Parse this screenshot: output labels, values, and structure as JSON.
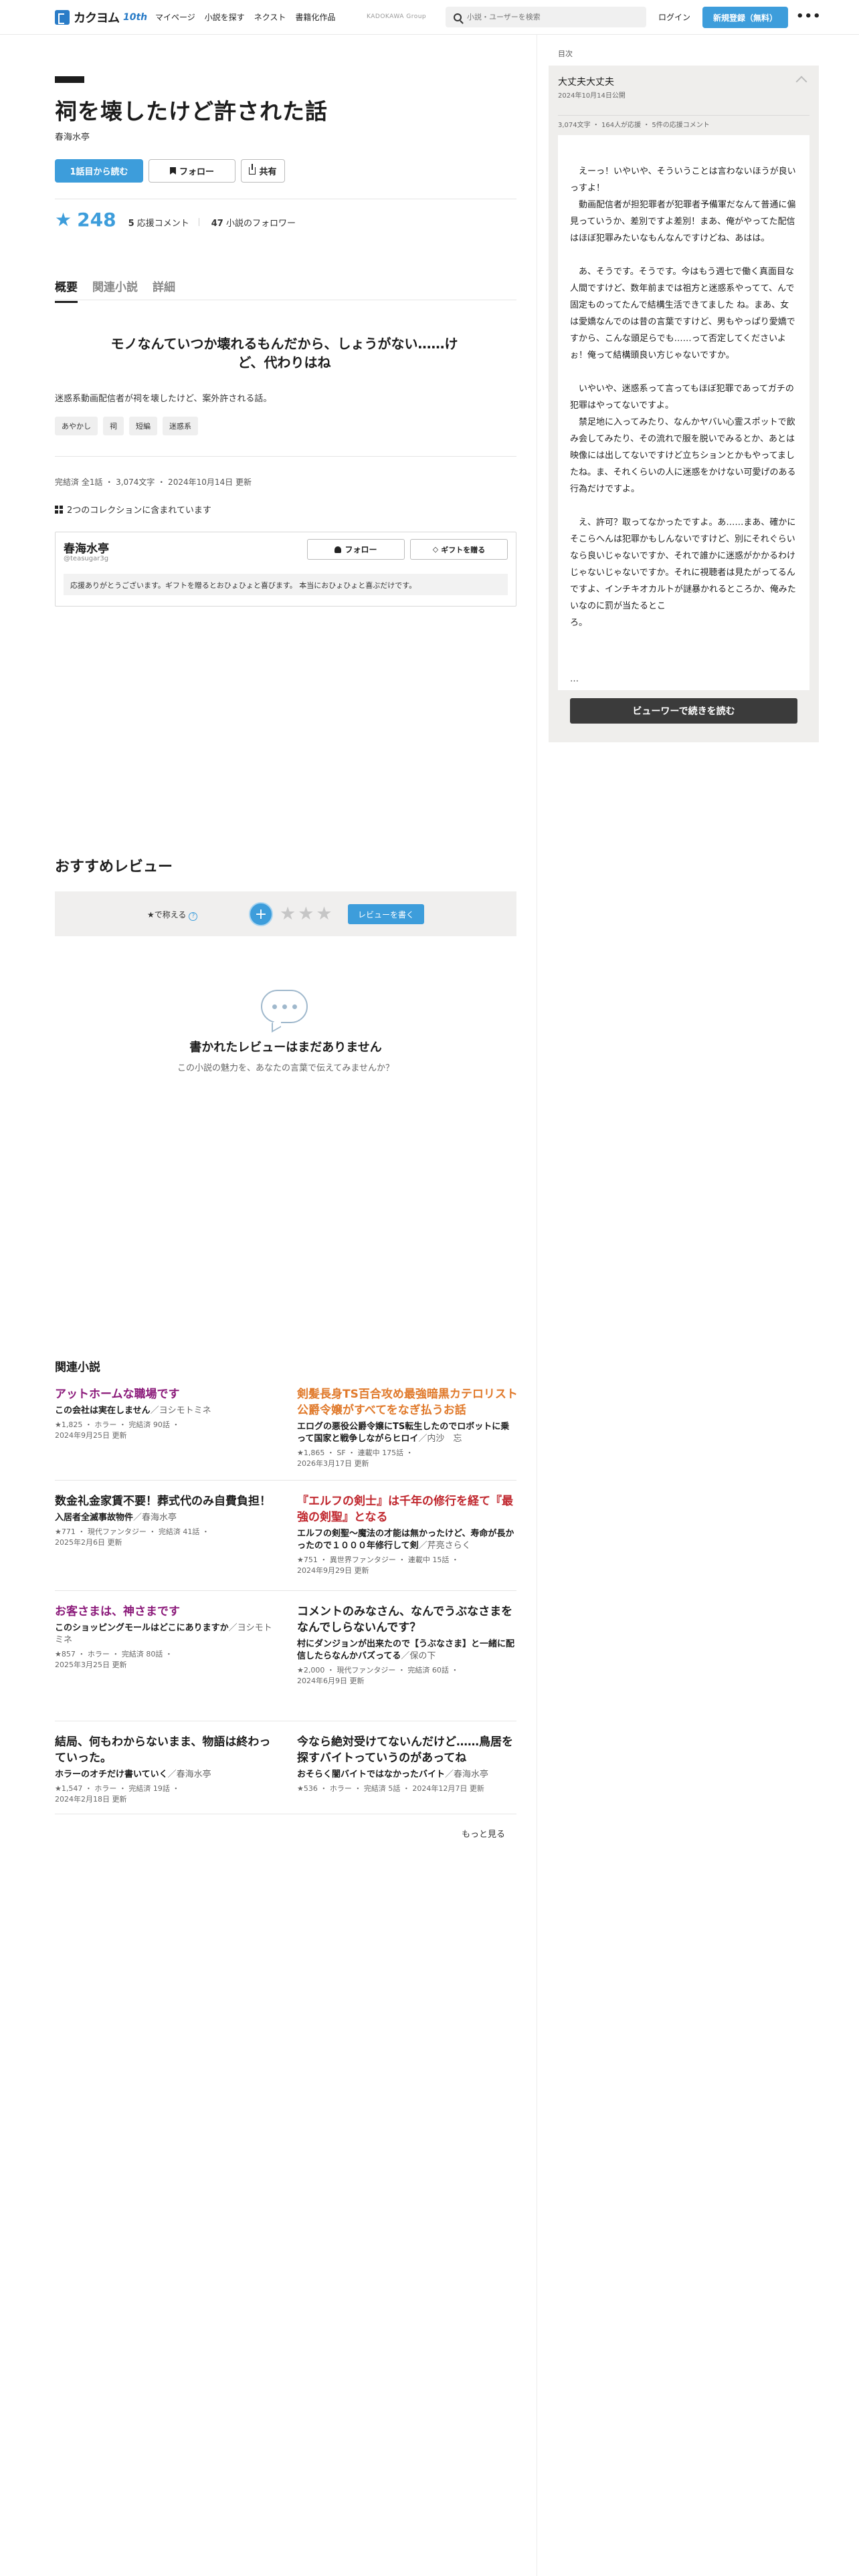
{
  "header": {
    "logo_text": "カクヨム",
    "logo_badge": "10th",
    "nav": [
      "マイページ",
      "小説を探す",
      "ネクスト",
      "書籍化作品"
    ],
    "group_label": "KADOKAWA Group",
    "search_placeholder": "小説・ユーザーを検索",
    "login_label": "ログイン",
    "signup_label": "新規登録（無料）",
    "more_label": "•••"
  },
  "work": {
    "title": "祠を壊したけど許された話",
    "author": "春海水亭",
    "read_button": "1話目から読む",
    "follow_button": "フォロー",
    "share_button": "共有",
    "star_symbol": "★",
    "stars": "248",
    "review_comments_count": "5",
    "review_comments_label": "応援コメント",
    "followers_count": "47",
    "followers_label": "小説のフォロワー"
  },
  "tabs": [
    "概要",
    "関連小説",
    "詳細"
  ],
  "overview": {
    "catchphrase": "モノなんていつか壊れるもんだから、しょうがない……けど、代わりはね",
    "introduction": "迷惑系動画配信者が祠を壊したけど、案外許される話。",
    "tags": [
      "あやかし",
      "祠",
      "短編",
      "迷惑系"
    ],
    "meta": "完結済 全1話 ・ 3,074文字 ・ 2024年10月14日 更新",
    "collections": "2つのコレクションに含まれています"
  },
  "author_box": {
    "name": "春海水亭",
    "id": "@teasugar3g",
    "follow_button": "フォロー",
    "gift_button": "ギフトを贈る",
    "message": "応援ありがとうございます。ギフトを贈るとおひょひょと喜びます。 本当におひょひょと喜ぶだけです。"
  },
  "reviews": {
    "section_title": "おすすめレビュー",
    "rating_label": "★で称える",
    "help_mark": "?",
    "plus_symbol": "+",
    "stars_symbol": "★★★",
    "write_button": "レビューを書く",
    "empty_title": "書かれたレビューはまだありません",
    "empty_sub": "この小説の魅力を、あなたの言葉で伝えてみませんか？"
  },
  "related": {
    "section_title": "関連小説",
    "more_label": "もっと見る",
    "items": [
      {
        "title": "アットホームな職場です",
        "color": "#8b1a7a",
        "catch": "この会社は実在しません",
        "author": "／ヨシモトミネ",
        "meta1": "★1,825 ・ ホラー ・ 完結済 90話 ・",
        "meta2": "2024年9月25日 更新"
      },
      {
        "title": "剣髪長身TS百合攻め最強暗黒カテロリスト公爵令嬢がすべてをなぎ払うお話",
        "color": "#e0792a",
        "catch": "エログの悪役公爵令嬢にTS転生したのでロボットに乗って国家と戦争しながらヒロイ",
        "author": "／内沙　忘",
        "meta1": "★1,865 ・ SF ・ 連載中 175話 ・",
        "meta2": "2026年3月17日 更新"
      },
      {
        "title": "数金礼金家賃不要！葬式代のみ自費負担！",
        "color": "#1c1c1c",
        "catch": "入居者全滅事故物件",
        "author": "／春海水亭",
        "meta1": "★771 ・ 現代ファンタジー ・ 完結済 41話 ・",
        "meta2": "2025年2月6日 更新"
      },
      {
        "title": "『エルフの剣士』は千年の修行を経て『最強の剣聖』となる",
        "color": "#c0262d",
        "catch": "エルフの剣聖〜魔法の才能は無かったけど、寿命が長かったので１０００年修行して剣",
        "author": "／芹亮さらく",
        "meta1": "★751 ・ 異世界ファンタジー ・ 連載中 15話 ・",
        "meta2": "2024年9月29日 更新"
      },
      {
        "title": "お客さまは、神さまです",
        "color": "#8b1a7a",
        "catch": "このショッピングモールはどこにありますか",
        "author": "／ヨシモトミネ",
        "meta1": "★857 ・ ホラー ・ 完結済 80話 ・",
        "meta2": "2025年3月25日 更新"
      },
      {
        "title": "コメントのみなさん、なんでうぶなさまをなんでしらないんです？",
        "color": "#1c1c1c",
        "catch": "村にダンジョンが出来たので【うぶなさま】と一緒に配信したらなんかバズってる",
        "author": "／保の下",
        "meta1": "★2,000 ・ 現代ファンタジー ・ 完結済 60話 ・",
        "meta2": "2024年6月9日 更新"
      },
      {
        "title": "結局、何もわからないまま、物語は終わっていった。",
        "color": "#1c1c1c",
        "catch": "ホラーのオチだけ書いていく",
        "author": "／春海水亭",
        "meta1": "★1,547 ・ ホラー ・ 完結済 19話 ・",
        "meta2": "2024年2月18日 更新"
      },
      {
        "title": "今なら絶対受けてないんだけど……鳥居を探すバイトっていうのがあってね",
        "color": "#1c1c1c",
        "catch": "おそらく闇バイトではなかったバイト",
        "author": "／春海水亭",
        "meta1": "★536 ・ ホラー ・ 完結済 5話 ・ 2024年12月7日 更新",
        "meta2": ""
      }
    ]
  },
  "episode": {
    "toc_label": "目次",
    "title": "大丈夫大丈夫",
    "date": "2024年10月14日公開",
    "stats": "3,074文字 ・ 164人が応援 ・ 5件の応援コメント",
    "paragraphs": [
      "えーっ！いやいや、そういうことは言わないほうが良いっすよ！",
      "動画配信者が担犯罪者が犯罪者予備軍だなんて普通に偏見っていうか、差別ですよ差別！まあ、俺がやってた配信はほぼ犯罪みたいなもんなんですけどね、あはは。",
      "あ、そうです。そうです。今はもう週七で働く真面目な人間ですけど、数年前までは祖方と迷惑系やってて、んで固定ものってたんで結構生活できてました ね。まあ、女は愛嬌なんでのは昔の言葉ですけど、男もやっぱり愛嬌ですから、こんな頭足らでも……って否定してくださいよぉ！俺って結構頭良い方じゃないですか。",
      "いやいや、迷惑系って言ってもほぼ犯罪であってガチの犯罪はやってないですよ。",
      "禁足地に入ってみたり、なんかヤバい心霊スポットで飲み会してみたり、その流れで服を脱いでみるとか、あとは映像には出してないですけど立ちションとかもやってましたね。ま、それくらいの人に迷惑をかけない可愛げのある行為だけですよ。",
      "え、許可？取ってなかったですよ。あ……まあ、確かにそこらへんは犯罪かもしんないですけど、別にそれぐらいなら良いじゃないですか、それで誰かに迷惑がかかるわけじゃないじゃないですか。それに視聴者は見たがってるんですよ、インチキオカルトが謎暴かれるところか、俺みたいなのに罰が当たるとこ",
      "ろ。"
    ],
    "ellipsis": "…",
    "read_button": "ビューワーで続きを読む"
  }
}
